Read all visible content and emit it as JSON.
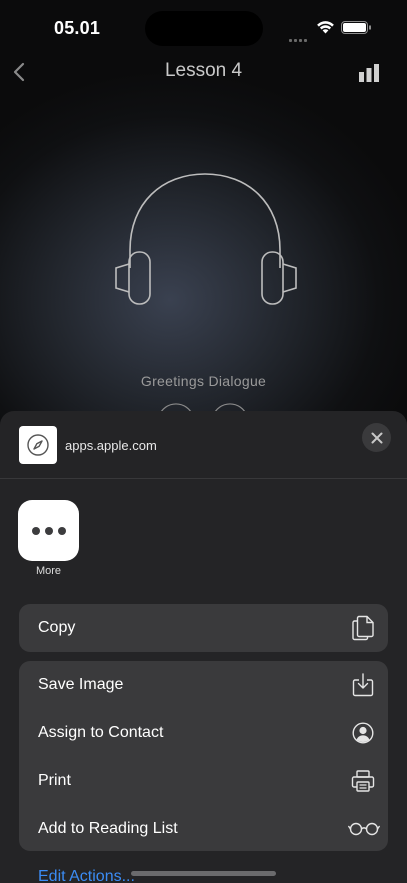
{
  "status_bar": {
    "time": "05.01"
  },
  "nav": {
    "title": "Lesson 4"
  },
  "player": {
    "track_name": "Greetings Dialogue"
  },
  "share_sheet": {
    "site_url": "apps.apple.com",
    "more_label": "More",
    "copy_label": "Copy",
    "actions": [
      {
        "label": "Save Image",
        "icon": "save-image-icon"
      },
      {
        "label": "Assign to Contact",
        "icon": "contact-icon"
      },
      {
        "label": "Print",
        "icon": "printer-icon"
      },
      {
        "label": "Add to Reading List",
        "icon": "glasses-icon"
      }
    ],
    "edit_actions_label": "Edit Actions..."
  },
  "colors": {
    "sheet_bg": "#242426",
    "row_bg": "#3a3a3c",
    "link": "#3b8cf5"
  }
}
